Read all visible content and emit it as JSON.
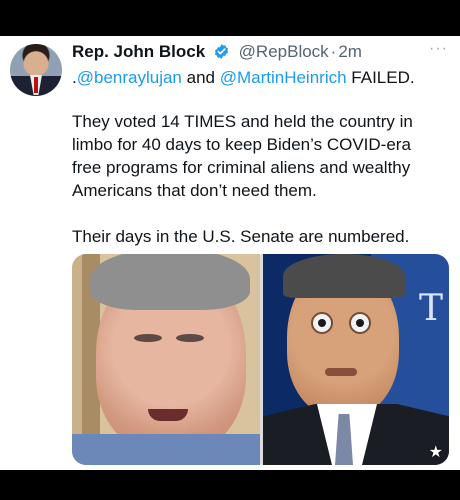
{
  "tweet": {
    "author_name": "Rep. John Block",
    "handle": "@RepBlock",
    "separator": "·",
    "time": "2m",
    "more_menu": "···",
    "reply_prefix": ".",
    "mention_1": "@benraylujan",
    "conjunction": " and ",
    "mention_2": "@MartinHeinrich",
    "reply_suffix": " FAILED.",
    "paragraph_1": "They voted 14 TIMES and held the country in limbo for 40 days to keep Biden’s COVID-era free programs for criminal aliens and wealthy Americans that don’t need them.",
    "paragraph_2": "Their days in the U.S. Senate are numbered."
  },
  "media": {
    "right_photo_letter": "T",
    "badge": "★"
  },
  "colors": {
    "link": "#1d9bf0",
    "verified": "#1d9bf0",
    "text": "#0f1419",
    "muted": "#536471"
  },
  "icons": {
    "verified": "verified-badge-icon",
    "more": "more-horizontal-icon",
    "star": "star-icon"
  }
}
